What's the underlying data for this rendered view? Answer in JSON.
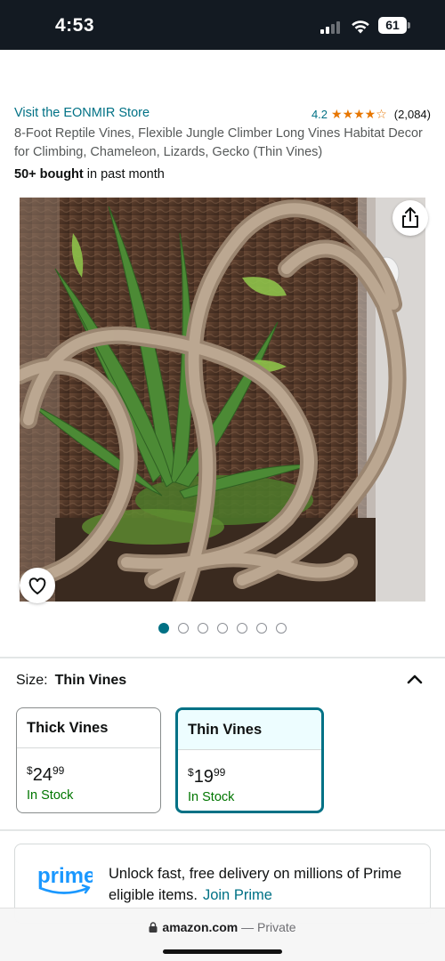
{
  "status_bar": {
    "time": "4:53",
    "battery": "61",
    "icons": [
      "signal-icon",
      "wifi-icon",
      "battery-icon"
    ]
  },
  "product": {
    "store_link": "Visit the EONMIR Store",
    "rating": "4.2",
    "stars": "★★★★☆",
    "rating_count": "(2,084)",
    "title": "8-Foot Reptile Vines, Flexible Jungle Climber Long Vines Habitat Decor for Climbing, Chameleon, Lizards, Gecko (Thin Vines)",
    "bought_bold": "50+ bought",
    "bought_rest": " in past month"
  },
  "gallery": {
    "image_count": 7,
    "active_index": 0,
    "icons": [
      "share-icon",
      "heart-icon"
    ]
  },
  "size": {
    "label": "Size:",
    "selected": "Thin Vines",
    "options": [
      {
        "name": "Thick Vines",
        "price_symbol": "$",
        "price_whole": "24",
        "price_fraction": "99",
        "stock": "In Stock",
        "selected": false
      },
      {
        "name": "Thin Vines",
        "price_symbol": "$",
        "price_whole": "19",
        "price_fraction": "99",
        "stock": "In Stock",
        "selected": true
      }
    ]
  },
  "prime": {
    "logo_text": "prime",
    "message": "Unlock fast, free delivery on millions of Prime eligible items.",
    "join_link": "Join Prime"
  },
  "browser": {
    "domain": "amazon.com",
    "separator": " — ",
    "mode": "Private"
  },
  "colors": {
    "link": "#007185",
    "star": "#e77600",
    "in_stock": "#007600",
    "selected_border": "#007185",
    "status_bar": "#131a22"
  }
}
